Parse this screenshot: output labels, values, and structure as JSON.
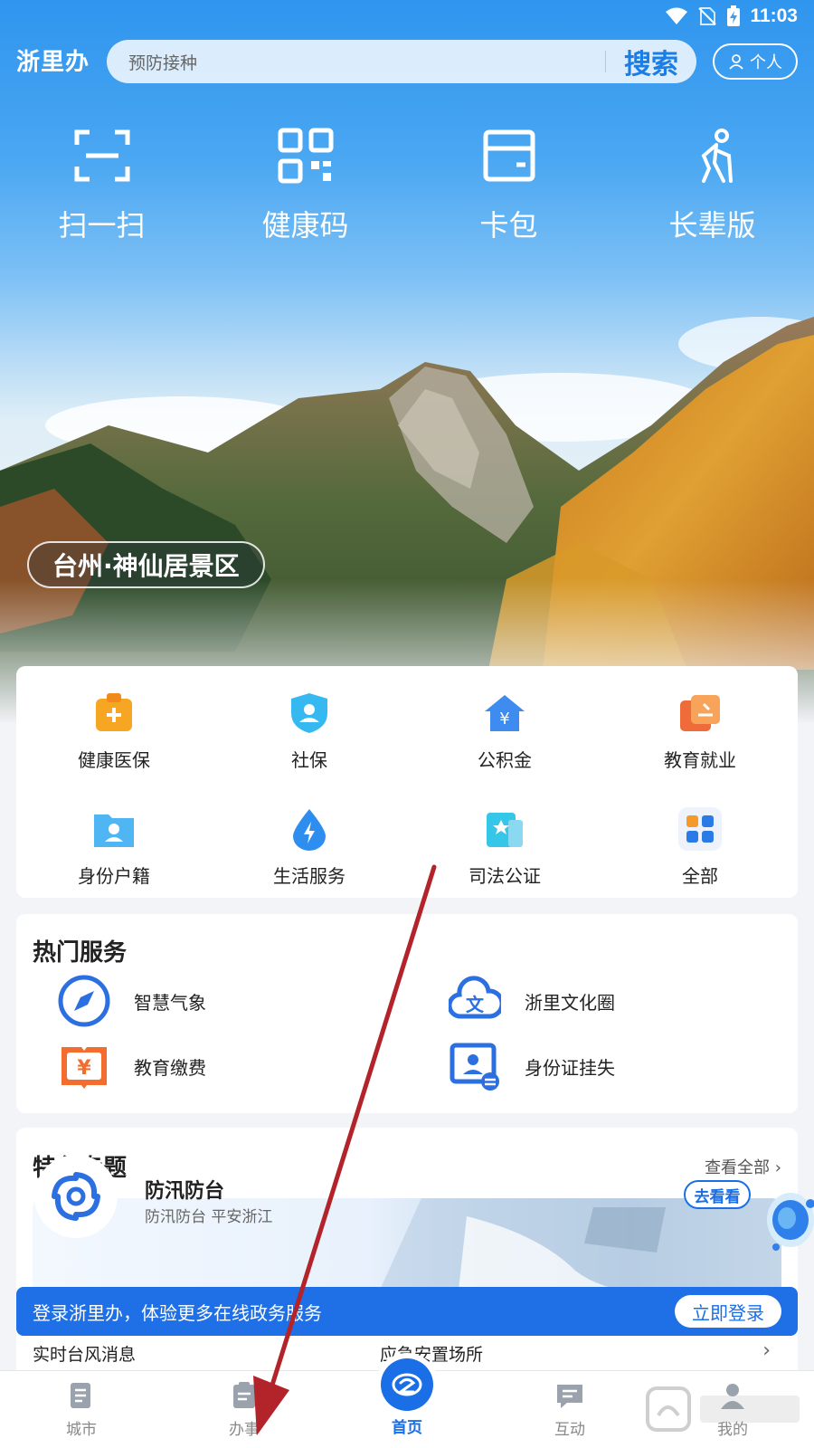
{
  "status_bar": {
    "time": "11:03"
  },
  "header": {
    "app_name": "浙里办",
    "search_placeholder": "预防接种",
    "search_label": "搜索",
    "personal_label": "个人"
  },
  "quick_actions": [
    {
      "label": "扫一扫",
      "icon": "scan-icon"
    },
    {
      "label": "健康码",
      "icon": "qr-code-icon"
    },
    {
      "label": "卡包",
      "icon": "wallet-icon"
    },
    {
      "label": "长辈版",
      "icon": "elder-icon"
    }
  ],
  "scenic_spot": "台州·神仙居景区",
  "services": [
    {
      "label": "健康医保",
      "icon": "medical-icon",
      "color": "#f5a02a"
    },
    {
      "label": "社保",
      "icon": "social-security-icon",
      "color": "#35b9f0"
    },
    {
      "label": "公积金",
      "icon": "housing-fund-icon",
      "color": "#3f8cf0"
    },
    {
      "label": "教育就业",
      "icon": "education-icon",
      "color": "#f06b3a"
    },
    {
      "label": "身份户籍",
      "icon": "id-folder-icon",
      "color": "#4fb6f3"
    },
    {
      "label": "生活服务",
      "icon": "life-service-icon",
      "color": "#2e8ef0"
    },
    {
      "label": "司法公证",
      "icon": "justice-icon",
      "color": "#36c6e8"
    },
    {
      "label": "全部",
      "icon": "all-apps-icon",
      "color": "#2b7be6"
    }
  ],
  "hot_services": {
    "title": "热门服务",
    "items": [
      {
        "label": "智慧气象",
        "icon": "compass-icon"
      },
      {
        "label": "浙里文化圈",
        "icon": "culture-cloud-icon"
      },
      {
        "label": "教育缴费",
        "icon": "payment-book-icon"
      },
      {
        "label": "身份证挂失",
        "icon": "id-card-icon"
      }
    ]
  },
  "featured": {
    "title": "特色专题",
    "see_all": "查看全部",
    "banner_title": "防汛防台",
    "banner_subtitle": "防汛防台 平安浙江",
    "banner_button": "去看看",
    "row2_left": "实时台风消息",
    "row2_right": "应急安置场所"
  },
  "login_banner": {
    "text": "登录浙里办，体验更多在线政务服务",
    "button": "立即登录"
  },
  "bottom_nav": [
    {
      "label": "城市",
      "icon": "city-icon",
      "active": false
    },
    {
      "label": "办事",
      "icon": "affairs-icon",
      "active": false
    },
    {
      "label": "首页",
      "icon": "home-icon",
      "active": true
    },
    {
      "label": "互动",
      "icon": "interact-icon",
      "active": false
    },
    {
      "label": "我的",
      "icon": "profile-icon",
      "active": false
    }
  ],
  "colors": {
    "primary": "#1a6ee6",
    "annotation_arrow": "#b3232a"
  }
}
